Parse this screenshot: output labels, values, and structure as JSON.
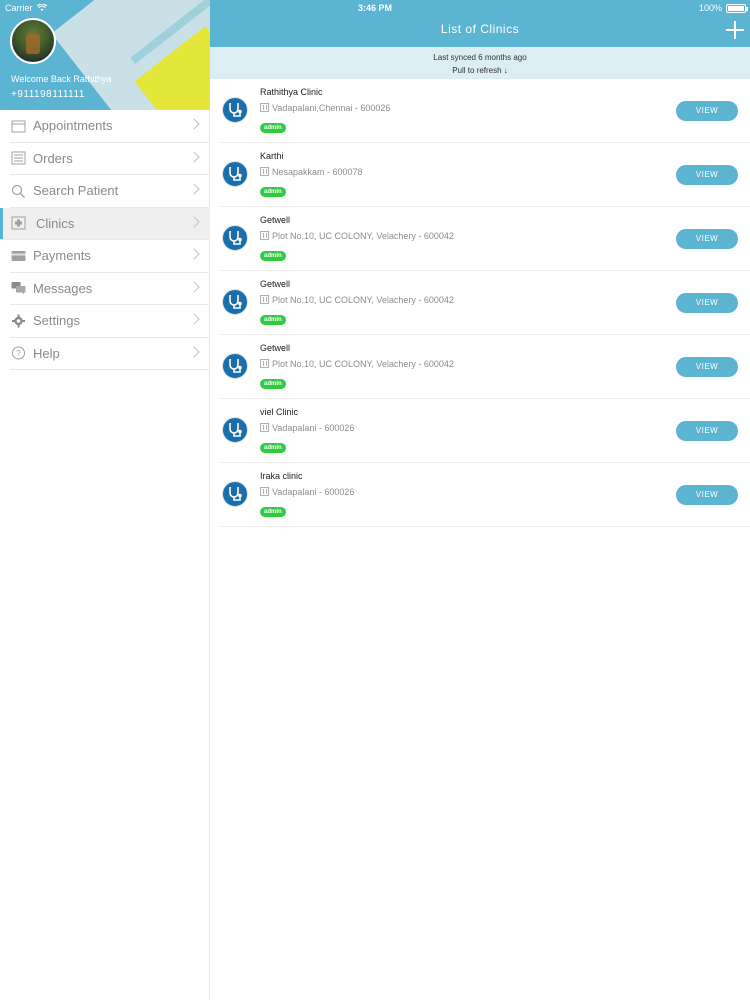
{
  "status_bar": {
    "carrier": "Carrier",
    "time": "3:46 PM",
    "battery": "100%"
  },
  "profile": {
    "welcome": "Welcome Back Rathithya",
    "phone": "+911198111111"
  },
  "menu": [
    {
      "label": "Appointments",
      "icon": "calendar-icon"
    },
    {
      "label": "Orders",
      "icon": "list-icon"
    },
    {
      "label": "Search Patient",
      "icon": "search-icon"
    },
    {
      "label": "Clinics",
      "icon": "clinic-icon"
    },
    {
      "label": "Payments",
      "icon": "card-icon"
    },
    {
      "label": "Messages",
      "icon": "chat-icon"
    },
    {
      "label": "Settings",
      "icon": "gear-icon"
    },
    {
      "label": "Help",
      "icon": "question-icon"
    }
  ],
  "active_menu": "Clinics",
  "header": {
    "title": "List of Clinics",
    "add_icon": "plus-icon"
  },
  "sync": {
    "status": "Last synced 6 months ago",
    "hint": "Pull to refresh ↓"
  },
  "clinics": [
    {
      "name": "Rathithya Clinic",
      "address": "Vadapalani,Chennai - 600026",
      "role": "admin",
      "action": "VIEW"
    },
    {
      "name": "Karthi",
      "address": "Nesapakkam - 600078",
      "role": "admin",
      "action": "VIEW"
    },
    {
      "name": "Getwell",
      "address": "Plot No.10, UC COLONY, Velachery - 600042",
      "role": "admin",
      "action": "VIEW"
    },
    {
      "name": "Getwell",
      "address": "Plot No.10, UC COLONY, Velachery - 600042",
      "role": "admin",
      "action": "VIEW"
    },
    {
      "name": "Getwell",
      "address": "Plot No.10, UC COLONY, Velachery - 600042",
      "role": "admin",
      "action": "VIEW"
    },
    {
      "name": "viel Clinic",
      "address": "Vadapalani - 600026",
      "role": "admin",
      "action": "VIEW"
    },
    {
      "name": "Iraka clinic",
      "address": "Vadapalani - 600026",
      "role": "admin",
      "action": "VIEW"
    }
  ],
  "colors": {
    "accent": "#5ab4d2",
    "badge": "#2ecc40",
    "icon_bg": "#1b6fa8"
  }
}
